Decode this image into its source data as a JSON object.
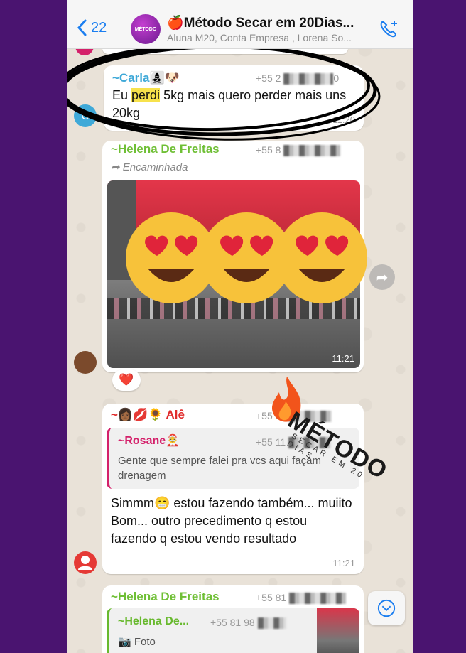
{
  "header": {
    "back_count": "22",
    "group_avatar_label": "MÉTODO",
    "title": "🍎Método Secar em 20Dias...",
    "subtitle": "Aluna M20, Conta Empresa , Lorena So..."
  },
  "messages": [
    {
      "sender": "~Carla👩‍👧‍👦🐶",
      "phone": "+55 2",
      "phone_tail": "0",
      "text_pre": "Eu ",
      "text_highlight": "perdi",
      "text_post": " 5kg mais quero perder mais uns 20kg",
      "time": "11:20",
      "avatar_letter": "C"
    },
    {
      "sender": "~Helena De Freitas",
      "phone": "+55 8",
      "forwarded": "Encaminhada",
      "time": "11:21",
      "reaction": "❤️",
      "stickers": [
        "😍",
        "😍",
        "😍"
      ]
    },
    {
      "sender": "~👩🏾💋🌻 Alê",
      "phone": "+55 61",
      "reply_sender": "~Rosane🤶",
      "reply_phone": "+55 11",
      "reply_text": "Gente que sempre falei pra vcs aqui façam drenagem",
      "text": "Simmm😁 estou fazendo também... muiito Bom... outro precedimento q estou fazendo q estou vendo resultado",
      "time": "11:21"
    },
    {
      "sender": "~Helena De Freitas",
      "phone": "+55 81",
      "reply_sender": "~Helena De...",
      "reply_phone": "+55 81 98",
      "reply_text": "Foto"
    }
  ],
  "watermark": {
    "brand": "MÉTODO",
    "tagline": "SECAR EM 20 DIAS"
  },
  "colors": {
    "accent_blue": "#1b7ef0",
    "carla_name": "#3fa9d8",
    "helena_name": "#6fbf35",
    "ale_name": "#e02b2b",
    "rosane_name": "#d4206a",
    "background_outer": "#4a1470"
  }
}
